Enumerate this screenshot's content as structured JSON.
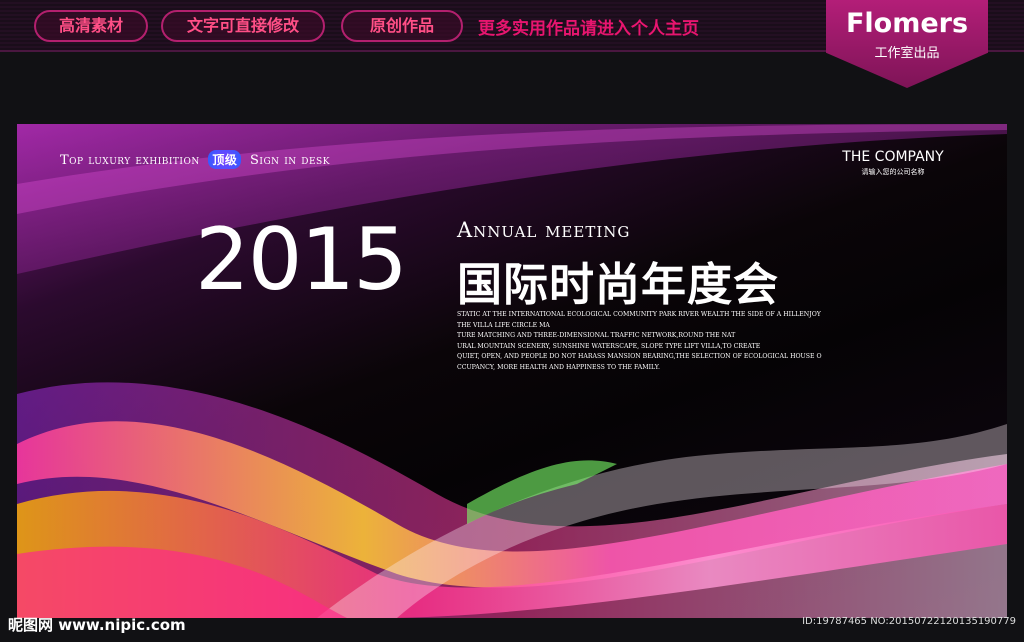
{
  "top_bar": {
    "pills": [
      "高清素材",
      "文字可直接修改",
      "原创作品"
    ],
    "tagline": "更多实用作品请进入个人主页",
    "brand_name": "Flomers",
    "brand_sub": "工作室出品"
  },
  "banner": {
    "top_left_before": "Top luxury exhibition",
    "badge": "顶级",
    "top_left_after": "Sign in desk",
    "company_name": "THE COMPANY",
    "company_sub": "请输入您的公司名称",
    "year": "2015",
    "subtitle": "Annual meeting",
    "title_cn": "国际时尚年度会",
    "body_lines": [
      "STATIC AT THE INTERNATIONAL ECOLOGICAL COMMUNITY PARK RIVER WEALTH THE SIDE OF A HILLENJOY",
      "THE VILLA LIFE CIRCLE MA",
      "TURE MATCHING AND THREE-DIMENSIONAL TRAFFIC NETWORK,ROUND THE NAT",
      "URAL MOUNTAIN SCENERY, SUNSHINE WATERSCAPE, SLOPE TYPE LIFT VILLA,TO CREATE",
      "QUIET, OPEN, AND PEOPLE DO NOT HARASS MANSION BEARING,THE SELECTION OF ECOLOGICAL HOUSE O",
      "CCUPANCY, MORE HEALTH AND HAPPINESS TO THE FAMILY."
    ]
  },
  "footer": {
    "watermark": "昵图网 www.nipic.com",
    "id_text": "ID:19787465 NO:20150722120135190779"
  },
  "colors": {
    "accent": "#e8156f",
    "brand": "#a01a6e"
  }
}
